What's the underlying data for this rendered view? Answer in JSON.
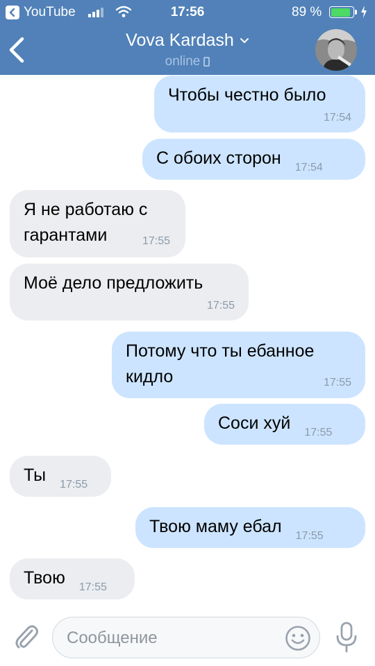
{
  "status_bar": {
    "back_app_label": "YouTube",
    "time": "17:56",
    "battery_percent": "89 %",
    "battery_level": 0.89
  },
  "header": {
    "contact_name": "Vova Kardash",
    "presence": "online"
  },
  "messages": [
    {
      "dir": "out",
      "text": "Чтобы честно было",
      "time": "17:54"
    },
    {
      "dir": "out",
      "text": "С обоих сторон",
      "time": "17:54"
    },
    {
      "dir": "in",
      "text": "Я не работаю с гарантами",
      "time": "17:55"
    },
    {
      "dir": "in",
      "text": "Моё дело предложить",
      "time": "17:55"
    },
    {
      "dir": "out",
      "text": "Потому что ты ебанное кидло",
      "time": "17:55"
    },
    {
      "dir": "out",
      "text": "Соси хуй",
      "time": "17:55"
    },
    {
      "dir": "in",
      "text": "Ты",
      "time": "17:55"
    },
    {
      "dir": "out",
      "text": "Твою маму ебал",
      "time": "17:55"
    },
    {
      "dir": "in",
      "text": "Твою",
      "time": "17:55"
    }
  ],
  "composer": {
    "placeholder": "Сообщение",
    "attach_icon": "paperclip-icon",
    "emoji_icon": "smiley-icon",
    "mic_icon": "microphone-icon"
  },
  "colors": {
    "header_bg": "#5181b8",
    "outgoing_bubble": "#cce4ff",
    "incoming_bubble": "#ebedf0",
    "timestamp": "#8b9aaa",
    "battery_fill": "#4cd964"
  }
}
